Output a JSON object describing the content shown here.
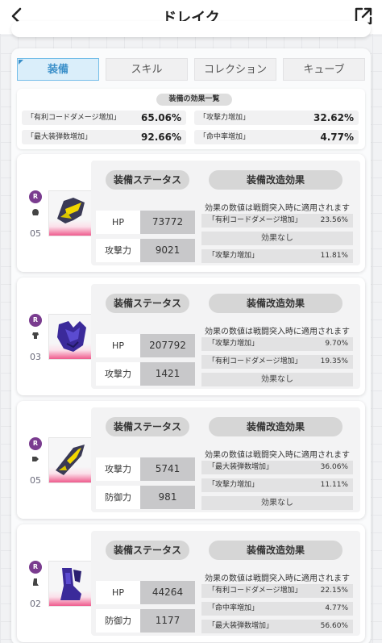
{
  "header": {
    "title": "ドレイク"
  },
  "tabs": [
    {
      "label": "装備",
      "active": true
    },
    {
      "label": "スキル",
      "active": false
    },
    {
      "label": "コレクション",
      "active": false
    },
    {
      "label": "キューブ",
      "active": false
    }
  ],
  "summary": {
    "title": "装備の効果一覧",
    "items": [
      {
        "name": "「有利コードダメージ増加」",
        "value": "65.06%"
      },
      {
        "name": "「攻撃力増加」",
        "value": "32.62%"
      },
      {
        "name": "「最大装弾数増加」",
        "value": "92.66%"
      },
      {
        "name": "「命中率増加」",
        "value": "4.77%"
      }
    ]
  },
  "common": {
    "status_label": "装備ステータス",
    "mod_label": "装備改造効果",
    "mod_note": "効果の数値は戦闘突入時に適用されます",
    "none_label": "効果なし",
    "rarity_badge": "R"
  },
  "equipment": [
    {
      "slot": "head",
      "level": "05",
      "color": "#f2d700",
      "stats": [
        {
          "label": "HP",
          "value": "73772"
        },
        {
          "label": "攻撃力",
          "value": "9021"
        }
      ],
      "mods": [
        {
          "name": "「有利コードダメージ増加」",
          "value": "23.56%"
        },
        {
          "none": true
        },
        {
          "name": "「攻撃力増加」",
          "value": "11.81%"
        }
      ]
    },
    {
      "slot": "body",
      "level": "03",
      "color": "#3b2a9a",
      "stats": [
        {
          "label": "HP",
          "value": "207792"
        },
        {
          "label": "攻撃力",
          "value": "1421"
        }
      ],
      "mods": [
        {
          "name": "「攻撃力増加」",
          "value": "9.70%"
        },
        {
          "name": "「有利コードダメージ増加」",
          "value": "19.35%"
        },
        {
          "none": true
        }
      ]
    },
    {
      "slot": "arm",
      "level": "05",
      "color": "#f2d700",
      "stats": [
        {
          "label": "攻撃力",
          "value": "5741"
        },
        {
          "label": "防御力",
          "value": "981"
        }
      ],
      "mods": [
        {
          "name": "「最大装弾数増加」",
          "value": "36.06%"
        },
        {
          "name": "「攻撃力増加」",
          "value": "11.11%"
        },
        {
          "none": true
        }
      ]
    },
    {
      "slot": "leg",
      "level": "02",
      "color": "#3b2a9a",
      "stats": [
        {
          "label": "HP",
          "value": "44264"
        },
        {
          "label": "防御力",
          "value": "1177"
        }
      ],
      "mods": [
        {
          "name": "「有利コードダメージ増加」",
          "value": "22.15%"
        },
        {
          "name": "「命中率増加」",
          "value": "4.77%"
        },
        {
          "name": "「最大装弾数増加」",
          "value": "56.60%"
        }
      ]
    }
  ]
}
